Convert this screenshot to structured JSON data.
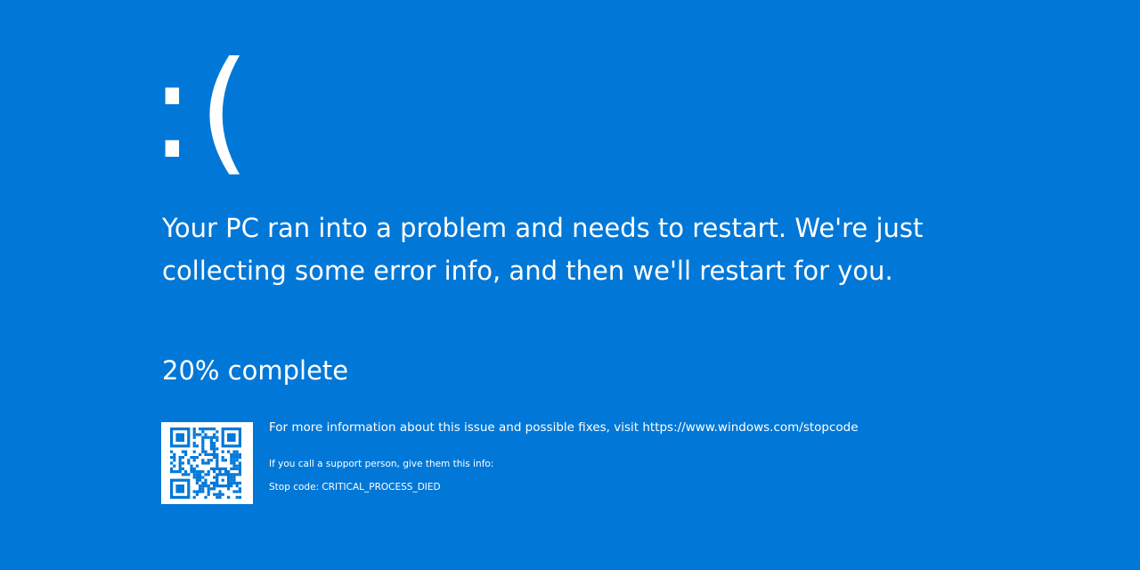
{
  "screen": {
    "background_color": "#0178d7",
    "text_color": "#ffffff",
    "emoticon": ":(",
    "message": "Your PC ran into a problem and needs to restart. We're just collecting some error info, and then we'll restart for you.",
    "progress_text": "20% complete",
    "progress_percent": 20,
    "qr_code_icon": "qr-code-icon",
    "more_info": "For more information about this issue and possible fixes, visit https://www.windows.com/stopcode",
    "support_info": "If you call a support person, give them this info:",
    "stop_code": "Stop code: CRITICAL_PROCESS_DIED"
  }
}
